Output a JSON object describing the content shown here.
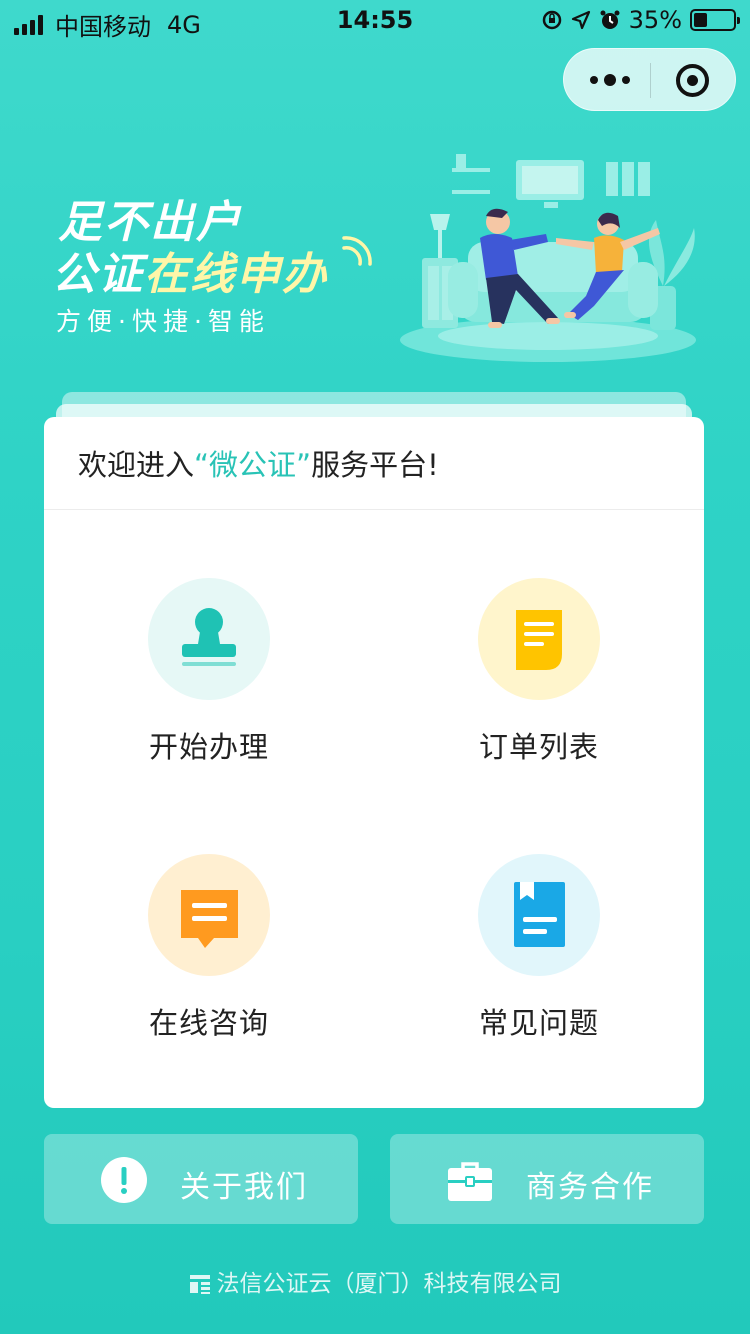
{
  "status_bar": {
    "carrier": "中国移动",
    "network": "4G",
    "time": "14:55",
    "battery_percent": "35%",
    "battery_level": 0.35
  },
  "capsule": {
    "more_icon": "more-dots-icon",
    "close_icon": "target-icon"
  },
  "banner": {
    "line1": "足不出户",
    "line2_prefix": "公证",
    "line2_highlight": "在线申办",
    "subtitle": "方便·快捷·智能"
  },
  "card": {
    "welcome_prefix": "欢迎进入",
    "welcome_brand": "“微公证”",
    "welcome_suffix": "服务平台!",
    "tiles": [
      {
        "label": "开始办理",
        "icon": "stamp-icon",
        "bg": "#e6f8f6",
        "color": "#1fc2b4"
      },
      {
        "label": "订单列表",
        "icon": "document-icon",
        "bg": "#fff5cc",
        "color": "#ffc400"
      },
      {
        "label": "在线咨询",
        "icon": "chat-icon",
        "bg": "#ffefd1",
        "color": "#ff9a1f"
      },
      {
        "label": "常见问题",
        "icon": "book-icon",
        "bg": "#e1f6fb",
        "color": "#1aa8e6"
      }
    ]
  },
  "bottom_buttons": {
    "about_label": "关于我们",
    "business_label": "商务合作"
  },
  "footer": {
    "company": "法信公证云（厦门）科技有限公司"
  },
  "colors": {
    "accent": "#29c3b6",
    "background": "#2fd3c6"
  }
}
